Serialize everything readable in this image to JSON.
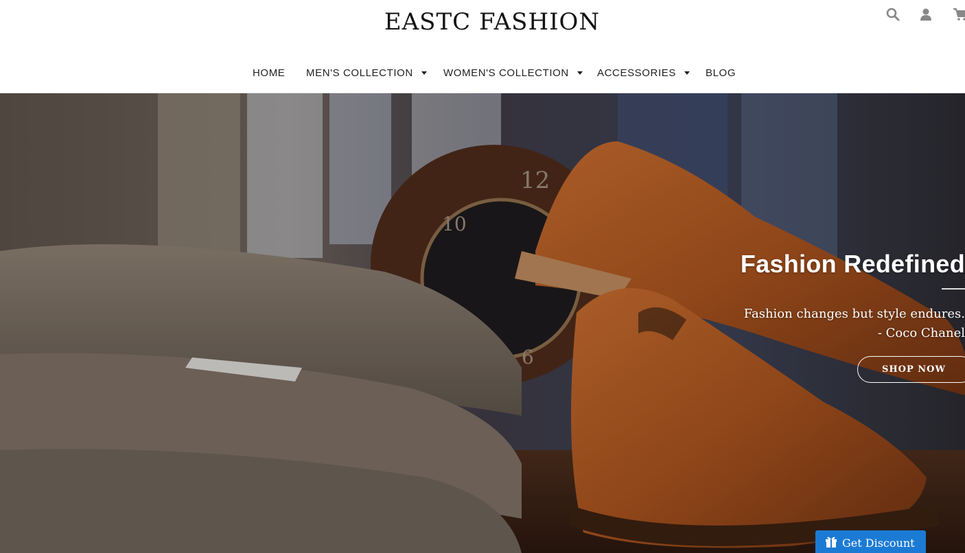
{
  "brand": {
    "logo_text": "EASTC FASHION"
  },
  "header_icons": [
    "search-icon",
    "user-icon",
    "cart-icon"
  ],
  "nav": {
    "items": [
      {
        "label": "HOME",
        "has_dropdown": false
      },
      {
        "label": "MEN'S COLLECTION",
        "has_dropdown": true
      },
      {
        "label": "WOMEN'S COLLECTION",
        "has_dropdown": true
      },
      {
        "label": "ACCESSORIES",
        "has_dropdown": true
      },
      {
        "label": "BLOG",
        "has_dropdown": false
      }
    ]
  },
  "hero": {
    "title": "Fashion Redefined",
    "quote_line1": "Fashion changes but style endures.",
    "quote_line2": "- Coco Chanel",
    "cta_label": "SHOP NOW"
  },
  "discount_widget": {
    "label": "Get Discount",
    "icon": "gift-icon",
    "color": "#1b7bd4"
  }
}
